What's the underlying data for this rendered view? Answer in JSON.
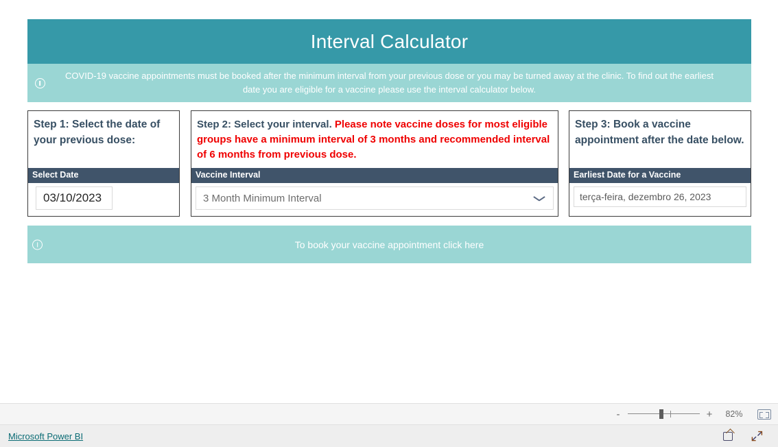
{
  "report": {
    "title": "Interval Calculator",
    "info_banner": {
      "icon": "info-icon",
      "text": "COVID-19 vaccine appointments must be booked after the minimum interval from your previous dose or you may be turned away at the clinic. To find out the earliest date you are eligible for a vaccine please use the interval calculator below."
    },
    "steps": [
      {
        "heading": "Step 1: Select the date of your previous dose:",
        "field_label": "Select Date",
        "value": "03/10/2023"
      },
      {
        "heading_normal": "Step 2: Select your interval. ",
        "heading_warning": "Please note vaccine doses for most eligible groups have a minimum interval of 3 months and recommended interval of 6 months from previous dose.",
        "field_label": "Vaccine Interval",
        "selected_option": "3 Month Minimum Interval",
        "dropdown_icon": "chevron-down-icon"
      },
      {
        "heading": "Step 3: Book a vaccine appointment after the date below.",
        "field_label": "Earliest Date for a Vaccine",
        "value": "terça-feira, dezembro 26, 2023"
      }
    ],
    "cta_banner": {
      "icon": "info-icon",
      "text": "To book your vaccine appointment click here"
    },
    "colors": {
      "title_bar": "#3699a8",
      "info_bar": "#9ad6d4",
      "field_header": "#40546a",
      "heading_text": "#374f63",
      "warning_text": "#ef0000"
    }
  },
  "toolbar": {
    "zoom_out_label": "-",
    "zoom_in_label": "+",
    "zoom_level": "82%",
    "fit_icon": "fit-to-screen-icon"
  },
  "footer": {
    "brand": "Microsoft Power BI",
    "share_icon": "share-icon",
    "fullscreen_icon": "expand-arrows-icon"
  }
}
